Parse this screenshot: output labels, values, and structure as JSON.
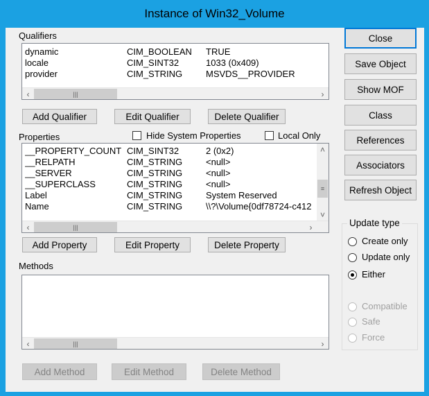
{
  "window": {
    "title": "Instance of Win32_Volume"
  },
  "qualifiers": {
    "label": "Qualifiers",
    "rows": [
      {
        "name": "dynamic",
        "type": "CIM_BOOLEAN",
        "value": "TRUE"
      },
      {
        "name": "locale",
        "type": "CIM_SINT32",
        "value": "1033 (0x409)"
      },
      {
        "name": "provider",
        "type": "CIM_STRING",
        "value": "MSVDS__PROVIDER"
      }
    ],
    "buttons": {
      "add": "Add Qualifier",
      "edit": "Edit Qualifier",
      "delete": "Delete Qualifier"
    }
  },
  "properties": {
    "label": "Properties",
    "hide_system_label": "Hide System Properties",
    "local_only_label": "Local Only",
    "rows": [
      {
        "name": "__PROPERTY_COUNT",
        "type": "CIM_SINT32",
        "value": "2 (0x2)"
      },
      {
        "name": "__RELPATH",
        "type": "CIM_STRING",
        "value": "<null>"
      },
      {
        "name": "__SERVER",
        "type": "CIM_STRING",
        "value": "<null>"
      },
      {
        "name": "__SUPERCLASS",
        "type": "CIM_STRING",
        "value": "<null>"
      },
      {
        "name": "Label",
        "type": "CIM_STRING",
        "value": "System Reserved"
      },
      {
        "name": "Name",
        "type": "CIM_STRING",
        "value": "\\\\?\\Volume{0df78724-c412"
      }
    ],
    "buttons": {
      "add": "Add Property",
      "edit": "Edit Property",
      "delete": "Delete Property"
    }
  },
  "methods": {
    "label": "Methods",
    "buttons": {
      "add": "Add Method",
      "edit": "Edit Method",
      "delete": "Delete Method"
    }
  },
  "side_buttons": {
    "close": "Close",
    "save": "Save Object",
    "show_mof": "Show MOF",
    "class": "Class",
    "references": "References",
    "associators": "Associators",
    "refresh": "Refresh Object"
  },
  "update_type": {
    "title": "Update type",
    "create_only": "Create only",
    "update_only": "Update only",
    "either": "Either",
    "compatible": "Compatible",
    "safe": "Safe",
    "force": "Force",
    "selected": "either"
  },
  "icons": {
    "left_arrow": "‹",
    "right_arrow": "›",
    "up_arrow": "˄",
    "down_arrow": "˅",
    "thumb_grip": "|||",
    "vthumb_grip": "≡"
  }
}
